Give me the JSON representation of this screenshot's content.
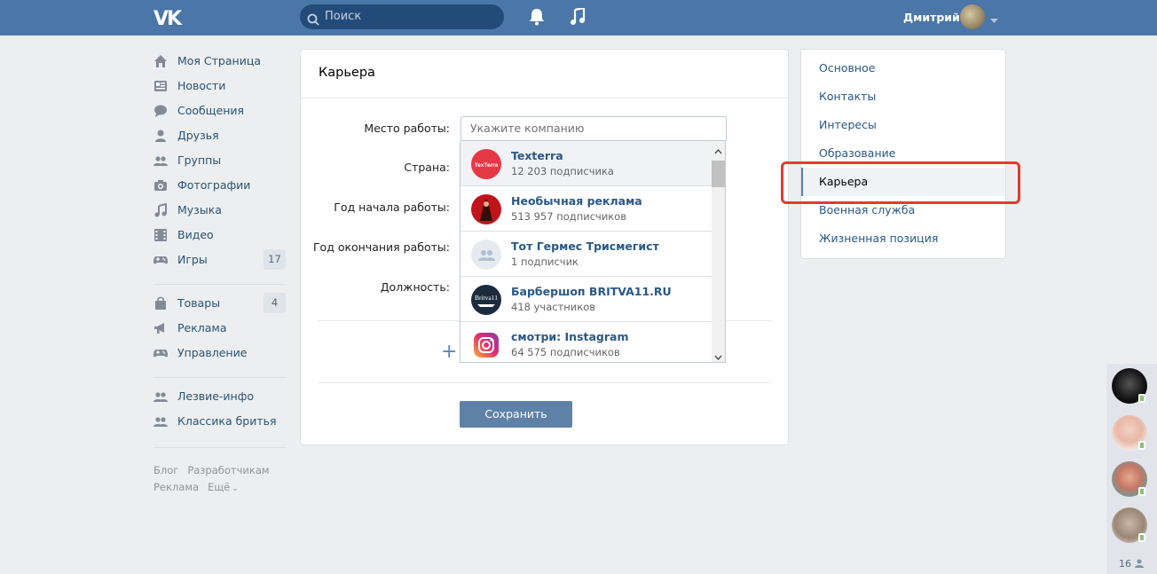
{
  "header": {
    "logo": "VK",
    "search_placeholder": "Поиск",
    "username": "Дмитрий"
  },
  "leftnav": {
    "items": [
      {
        "label": "Моя Страница",
        "icon": "home-icon"
      },
      {
        "label": "Новости",
        "icon": "news-icon"
      },
      {
        "label": "Сообщения",
        "icon": "messages-icon"
      },
      {
        "label": "Друзья",
        "icon": "friend-icon"
      },
      {
        "label": "Группы",
        "icon": "groups-icon"
      },
      {
        "label": "Фотографии",
        "icon": "camera-icon"
      },
      {
        "label": "Музыка",
        "icon": "music-icon"
      },
      {
        "label": "Видео",
        "icon": "video-icon"
      },
      {
        "label": "Игры",
        "icon": "gamepad-icon",
        "count": "17"
      }
    ],
    "items2": [
      {
        "label": "Товары",
        "icon": "bag-icon",
        "count": "4"
      },
      {
        "label": "Реклама",
        "icon": "megaphone-icon"
      },
      {
        "label": "Управление",
        "icon": "gamepad-icon"
      }
    ],
    "items3": [
      {
        "label": "Лезвие-инфо",
        "icon": "groups-icon"
      },
      {
        "label": "Классика бритья",
        "icon": "groups-icon"
      }
    ],
    "footer": [
      "Блог",
      "Разработчикам",
      "Реклама",
      "Ещё"
    ]
  },
  "card": {
    "title": "Карьера",
    "labels": {
      "workplace": "Место работы:",
      "country": "Страна:",
      "start_year": "Год начала работы:",
      "end_year": "Год окончания работы:",
      "position": "Должность:"
    },
    "company_placeholder": "Укажите компанию",
    "add_symbol": "+",
    "save_label": "Сохранить"
  },
  "dropdown": {
    "items": [
      {
        "name": "Texterra",
        "subtitle": "12 203 подписчика",
        "avatar_text": "TexTerra",
        "color": "#e53945"
      },
      {
        "name": "Необычная реклама",
        "subtitle": "513 957 подписчиков",
        "avatar_text": "",
        "color": "#c0141a"
      },
      {
        "name": "Тот Гермес Трисмегист",
        "subtitle": "1 подписчик",
        "avatar_text": "",
        "color": "#e6ebf1"
      },
      {
        "name": "Барбершоп BRITVA11.RU",
        "subtitle": "418 участников",
        "avatar_text": "Britva11",
        "color": "#1c2b3e"
      },
      {
        "name": "смотри: Instagram",
        "subtitle": "64 575 подписчиков",
        "avatar_text": "",
        "color": "#d4337c"
      }
    ]
  },
  "rightmenu": {
    "items": [
      {
        "label": "Основное",
        "active": false
      },
      {
        "label": "Контакты",
        "active": false
      },
      {
        "label": "Интересы",
        "active": false
      },
      {
        "label": "Образование",
        "active": false
      },
      {
        "label": "Карьера",
        "active": true
      },
      {
        "label": "Военная служба",
        "active": false
      },
      {
        "label": "Жизненная позиция",
        "active": false
      }
    ]
  },
  "friends": {
    "online_count": "16"
  },
  "colors": {
    "header_bg": "#4a76a8",
    "link": "#2a5885",
    "button": "#5e81a8",
    "highlight": "#e53a2e"
  }
}
